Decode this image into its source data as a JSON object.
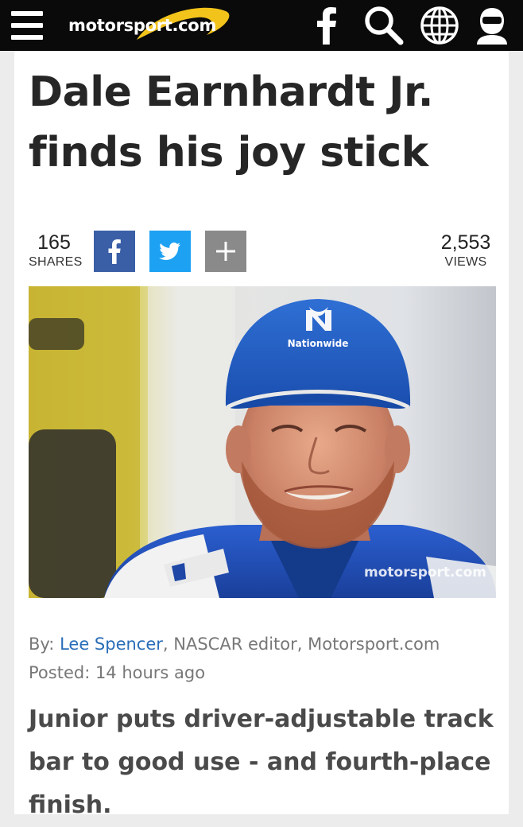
{
  "header": {
    "logo_text": "motorsport.com",
    "icons": [
      "menu-icon",
      "facebook-icon",
      "search-icon",
      "globe-icon",
      "user-icon"
    ]
  },
  "article": {
    "headline_line1": "Dale Earnhardt Jr.",
    "headline_line2": "finds his joy stick",
    "shares_count": "165",
    "shares_label": "SHARES",
    "views_count": "2,553",
    "views_label": "VIEWS",
    "share_more_label": "+",
    "photo_watermark": "motorsport.com",
    "photo_cap_text": "Nationwide",
    "byline_prefix": "By: ",
    "author": "Lee Spencer",
    "byline_suffix": ", NASCAR editor, Motorsport.com",
    "posted": "Posted: 14 hours ago",
    "summary": "Junior puts driver-adjustable track bar to good use - and fourth-place finish."
  },
  "colors": {
    "header_bg": "#0a0a0a",
    "logo_swoosh": "#f2c31b",
    "facebook": "#3a5fa6",
    "twitter": "#1da1f2",
    "more": "#8a8a8a",
    "link": "#2a6db8"
  }
}
